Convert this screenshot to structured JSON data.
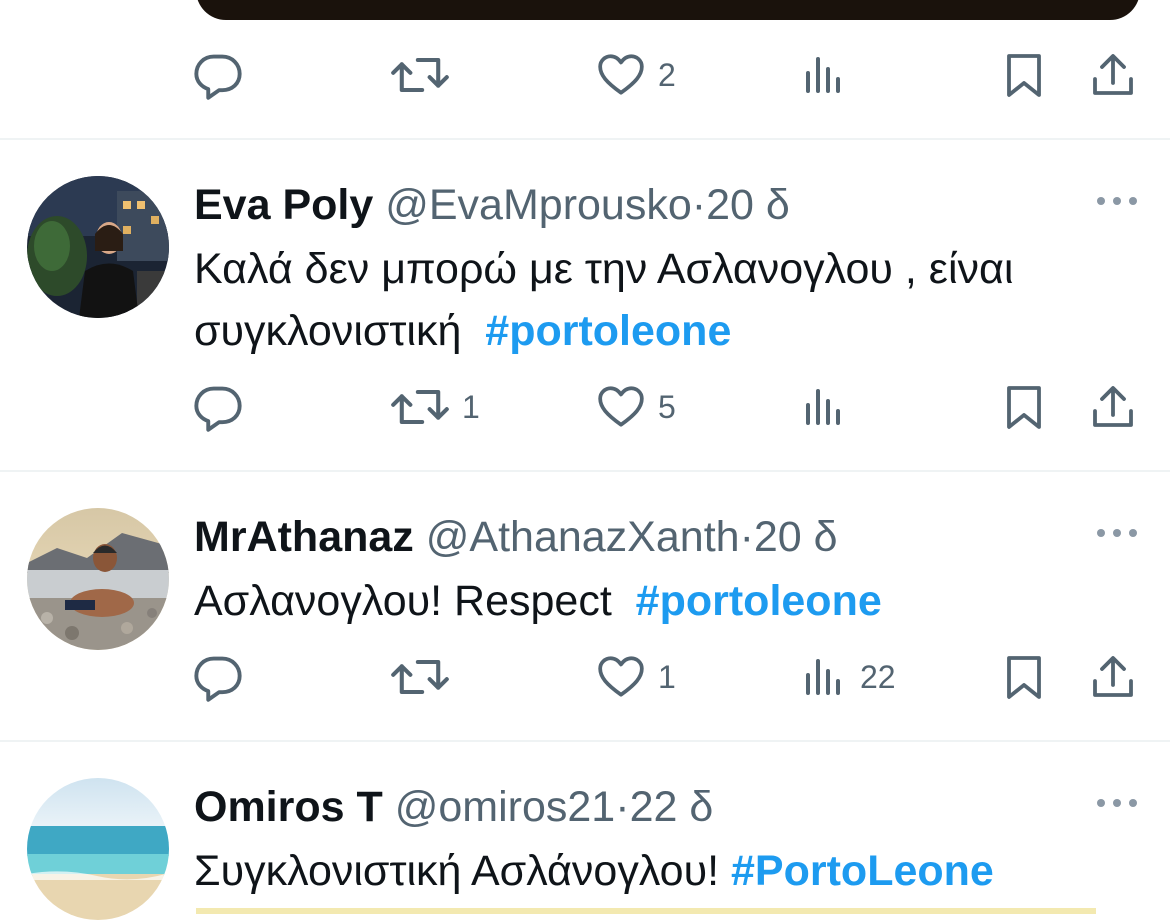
{
  "top_actions": {
    "reply": "",
    "retweet": "",
    "like": "2",
    "views": ""
  },
  "tweets": [
    {
      "name": "Eva Poly",
      "handle": "@EvaMprousko",
      "dot": "·",
      "time": "20 δ",
      "text": "Καλά δεν μπορώ με την Ασλανογλου , είναι συγκλονιστική",
      "hashtag": "#portoleone",
      "replies": "",
      "retweets": "1",
      "likes": "5",
      "views": ""
    },
    {
      "name": "MrAthanaz",
      "handle": "@AthanazXanth",
      "dot": "·",
      "time": "20 δ",
      "text": "Ασλανογλου! Respect",
      "hashtag": "#portoleone",
      "replies": "",
      "retweets": "",
      "likes": "1",
      "views": "22"
    },
    {
      "name": "Omiros T",
      "handle": "@omiros21",
      "dot": "·",
      "time": "22 δ",
      "text": "Συγκλονιστική Ασλάνογλου!",
      "hashtag": "#PortoLeone"
    }
  ],
  "icons": {
    "reply": "speech-bubble-icon",
    "retweet": "retweet-arrows-icon",
    "like": "heart-icon",
    "views": "bar-chart-icon",
    "bookmark": "bookmark-icon",
    "share": "share-upload-icon",
    "more": "more-dots-icon"
  },
  "colors": {
    "link": "#1d9bf0",
    "secondary_text": "#536471",
    "primary_text": "#0f1419",
    "separator": "#eff3f4"
  }
}
